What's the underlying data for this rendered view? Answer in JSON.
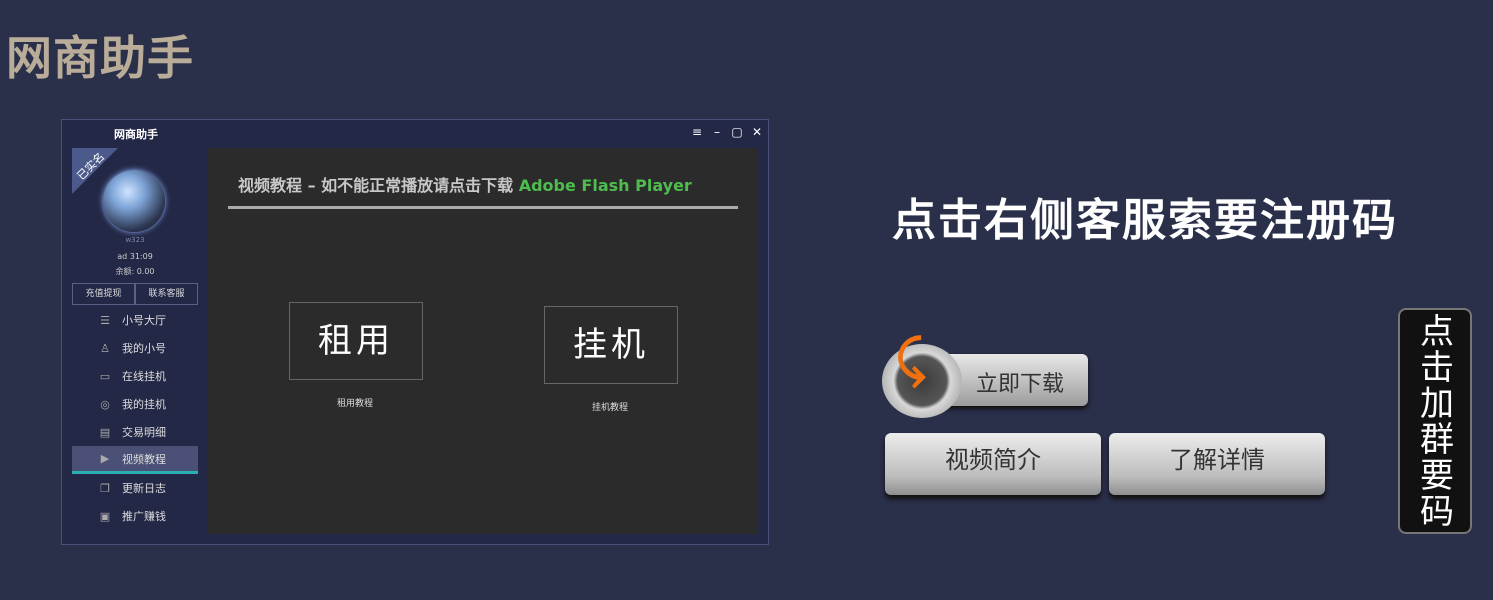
{
  "logo": "网商助手",
  "window": {
    "title": "网商助手",
    "controls": [
      "≡",
      "–",
      "▢",
      "✕"
    ],
    "badge": "已实名",
    "username": "w323",
    "info_line1": "ad  31:09",
    "info_line2": "余额: 0.00",
    "actions": [
      "充值提现",
      "联系客服"
    ],
    "menu": [
      {
        "label": "小号大厅",
        "icon": "list-icon"
      },
      {
        "label": "我的小号",
        "icon": "user-icon"
      },
      {
        "label": "在线挂机",
        "icon": "monitor-icon"
      },
      {
        "label": "我的挂机",
        "icon": "lock-icon"
      },
      {
        "label": "交易明细",
        "icon": "printer-icon"
      },
      {
        "label": "视频教程",
        "icon": "play-icon",
        "active": true
      },
      {
        "label": "更新日志",
        "icon": "document-icon"
      },
      {
        "label": "推广赚钱",
        "icon": "gift-icon"
      }
    ],
    "content": {
      "title_main": "视频教程 – 如不能正常播放请点击下载 ",
      "title_link": "Adobe Flash Player",
      "rent_button": "租用",
      "rent_label": "租用教程",
      "hang_button": "挂机",
      "hang_label": "挂机教程"
    }
  },
  "right": {
    "headline": "点击右侧客服索要注册码",
    "download_button": "立即下载",
    "video_button": "视频简介",
    "detail_button": "了解详情",
    "group_button": "点击加群要码"
  },
  "colors": {
    "background": "#2a2f4a",
    "accent": "#2ab0b0",
    "link": "#4ebc4e",
    "arrow": "#f07010"
  }
}
